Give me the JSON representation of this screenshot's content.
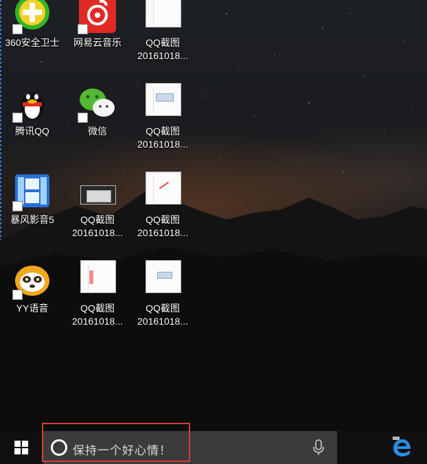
{
  "desktop": {
    "icons": [
      {
        "label": "360安全卫士"
      },
      {
        "label": "网易云音乐"
      },
      {
        "label": "QQ截图",
        "sub": "20161018..."
      },
      {
        "label": "腾讯QQ"
      },
      {
        "label": "微信"
      },
      {
        "label": "QQ截图",
        "sub": "20161018..."
      },
      {
        "label": "暴风影音5"
      },
      {
        "label": "QQ截图",
        "sub": "20161018..."
      },
      {
        "label": "QQ截图",
        "sub": "20161018..."
      },
      {
        "label": "YY语音"
      },
      {
        "label": "QQ截图",
        "sub": "20161018..."
      },
      {
        "label": "QQ截图",
        "sub": "20161018..."
      }
    ]
  },
  "taskbar": {
    "search": {
      "placeholder": "保持一个好心情！"
    },
    "start_icon": "windows-logo-icon",
    "mic_icon": "microphone-icon",
    "pinned": [
      {
        "icon": "edge-icon"
      }
    ]
  },
  "colors": {
    "highlight": "#d83a3a",
    "taskbar": "#101010",
    "search_box": "#3b3b3b",
    "start_logo": "#ffffff"
  }
}
